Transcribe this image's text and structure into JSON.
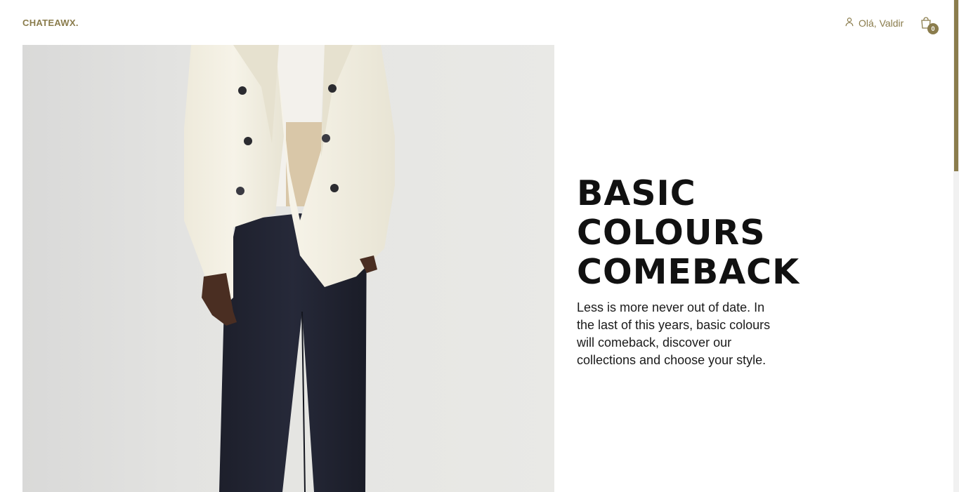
{
  "brand": {
    "logo": "CHATEAWX.",
    "accent": "#8a7c4c"
  },
  "header": {
    "user_greeting": "Olá, Valdir",
    "user_icon": "user-icon",
    "cart_icon": "shopping-bag-icon",
    "cart_count": "0"
  },
  "hero": {
    "title_lines": [
      "BASIC",
      "COLOURS",
      "COMEBACK"
    ],
    "description": "Less is more never out of date. In the last of this years, basic colours will comeback, discover our collections and choose your style.",
    "image_alt": "Model wearing white double-breasted blazer and navy trousers"
  },
  "scroll": {
    "position": 0
  }
}
